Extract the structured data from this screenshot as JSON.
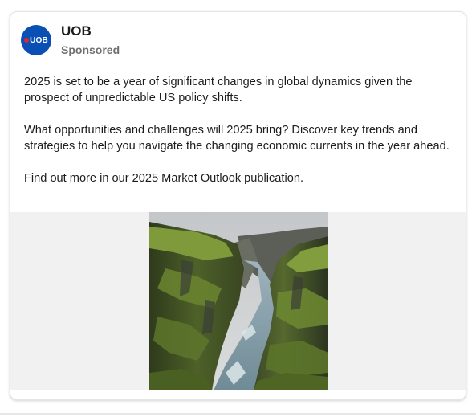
{
  "post": {
    "brand_name": "UOB",
    "sponsored_label": "Sponsored",
    "avatar_text": "UOB",
    "paragraphs": [
      "2025 is set to be a year of significant changes in global dynamics given the prospect of unpredictable US policy shifts.",
      "What opportunities and challenges will 2025 bring? Discover key trends and strategies to help you navigate the changing economic currents in the year ahead.",
      "Find out more in our 2025 Market Outlook publication."
    ]
  },
  "colors": {
    "brand_blue": "#0a4fb4",
    "brand_red": "#e3242b",
    "media_background": "#f1f1f1"
  },
  "icons": {
    "avatar": "uob-logo-icon"
  }
}
